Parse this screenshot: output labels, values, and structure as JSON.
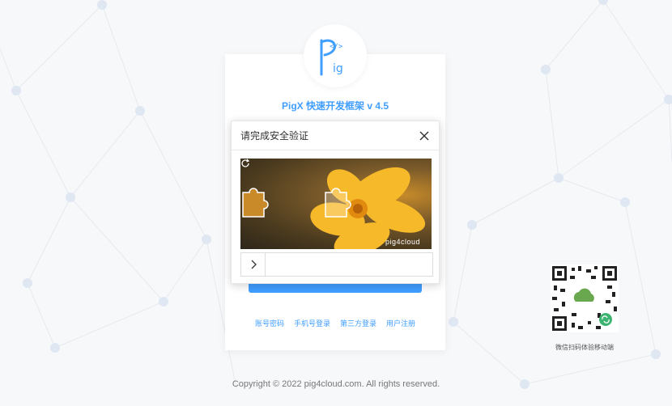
{
  "app": {
    "title": "PigX 快速开发框架 v 4.5",
    "logo_text": "Pig",
    "logo_code": "</>"
  },
  "login": {
    "links": [
      "账号密码",
      "手机号登录",
      "第三方登录",
      "用户注册"
    ]
  },
  "captcha": {
    "title": "请完成安全验证",
    "watermark": "pig4cloud",
    "close_icon": "close-icon",
    "refresh_icon": "refresh-icon",
    "slider_icon": "chevron-right-icon"
  },
  "qr": {
    "caption": "微信扫码体验移动端"
  },
  "footer": {
    "copyright": "Copyright © 2022 pig4cloud.com. All rights reserved."
  },
  "colors": {
    "accent": "#409eff",
    "background": "#f7f8fa",
    "mini_program_green": "#3cb371"
  }
}
